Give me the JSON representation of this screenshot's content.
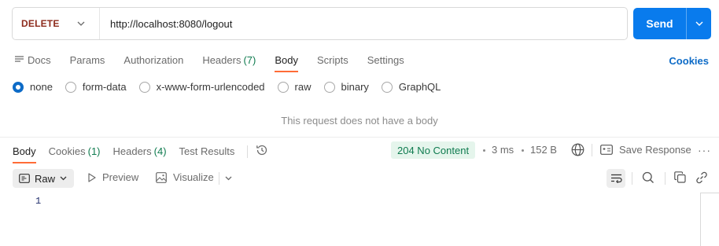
{
  "request": {
    "method": "DELETE",
    "url": "http://localhost:8080/logout",
    "send_label": "Send",
    "cookies_label": "Cookies"
  },
  "request_tabs": [
    {
      "label": "Docs",
      "icon": "docs-icon"
    },
    {
      "label": "Params"
    },
    {
      "label": "Authorization"
    },
    {
      "label": "Headers",
      "count": "(7)"
    },
    {
      "label": "Body",
      "active": true
    },
    {
      "label": "Scripts"
    },
    {
      "label": "Settings"
    }
  ],
  "body_types": [
    {
      "label": "none",
      "selected": true
    },
    {
      "label": "form-data"
    },
    {
      "label": "x-www-form-urlencoded"
    },
    {
      "label": "raw"
    },
    {
      "label": "binary"
    },
    {
      "label": "GraphQL"
    }
  ],
  "empty_body_message": "This request does not have a body",
  "response": {
    "tabs": [
      {
        "label": "Body",
        "active": true
      },
      {
        "label": "Cookies",
        "count": "(1)"
      },
      {
        "label": "Headers",
        "count": "(4)"
      },
      {
        "label": "Test Results"
      }
    ],
    "status": "204 No Content",
    "time": "3 ms",
    "size": "152 B",
    "save_label": "Save Response",
    "more_label": "···",
    "view_mode": "Raw",
    "preview_label": "Preview",
    "visualize_label": "Visualize",
    "line_numbers": [
      "1"
    ]
  },
  "colors": {
    "accent": "#ff6c37",
    "primary": "#097bed",
    "method_delete": "#8d2b1c",
    "status_ok": "#0f7b4f",
    "status_bg": "#e5f5ec",
    "link": "#0d6bc7"
  }
}
